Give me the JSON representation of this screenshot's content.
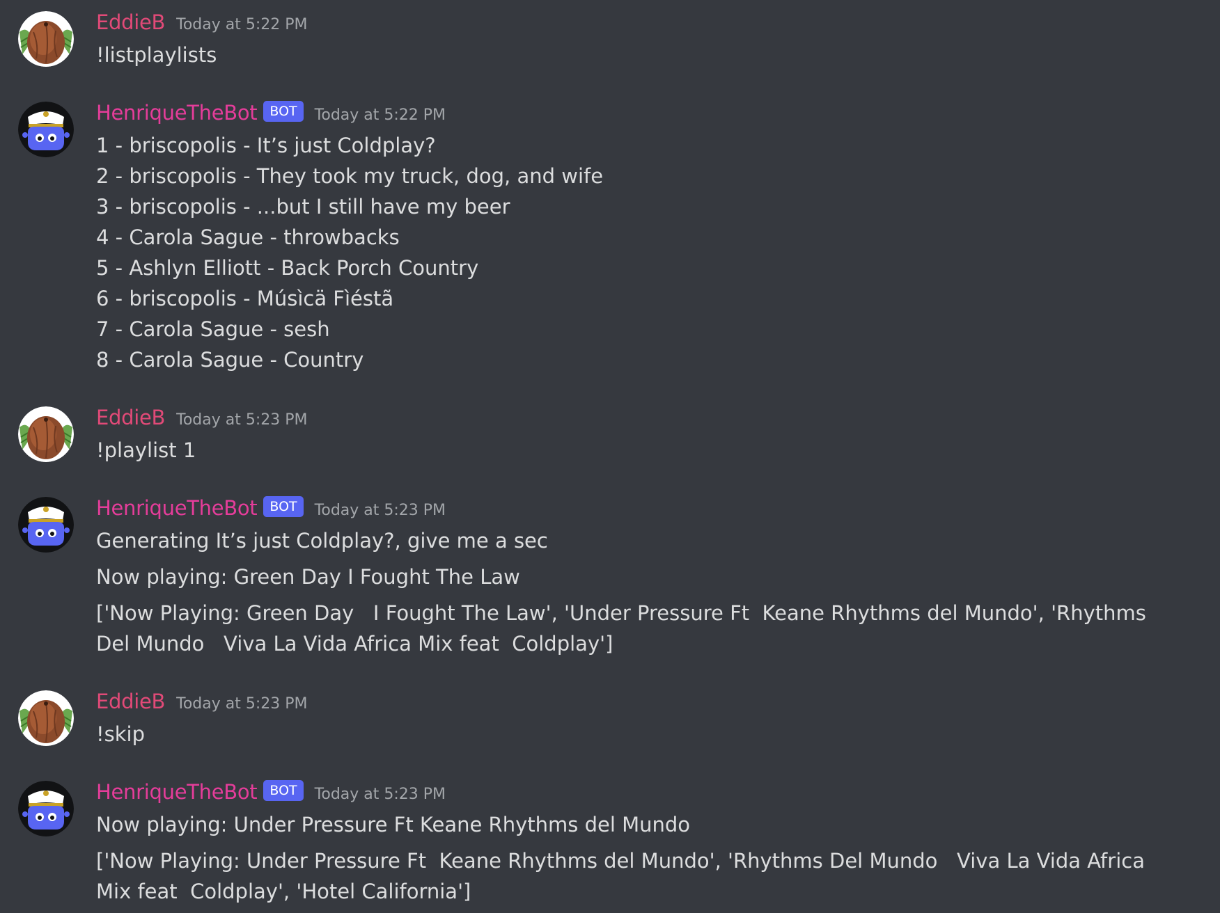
{
  "messages": [
    {
      "author": "EddieB",
      "is_bot": false,
      "timestamp": "Today at 5:22 PM",
      "lines": [
        "!listplaylists"
      ]
    },
    {
      "author": "HenriqueTheBot",
      "is_bot": true,
      "bot_tag": "BOT",
      "timestamp": "Today at 5:22 PM",
      "lines": [
        "1 - briscopolis - It’s just Coldplay?",
        "2 - briscopolis - They took my truck, dog, and wife",
        "3 - briscopolis - ...but I still have my beer",
        "4 - Carola Sague - throwbacks",
        "5 - Ashlyn Elliott - Back Porch Country",
        "6 - briscopolis - Músìcä Fìéstã",
        "7 - Carola Sague - sesh",
        "8 - Carola Sague - Country"
      ]
    },
    {
      "author": "EddieB",
      "is_bot": false,
      "timestamp": "Today at 5:23 PM",
      "lines": [
        "!playlist 1"
      ]
    },
    {
      "author": "HenriqueTheBot",
      "is_bot": true,
      "bot_tag": "BOT",
      "timestamp": "Today at 5:23 PM",
      "lines": [
        "Generating It’s just Coldplay?, give me a sec",
        "Now playing: Green Day   I Fought The Law",
        "['Now Playing: Green Day   I Fought The Law', 'Under Pressure Ft  Keane Rhythms del Mundo', 'Rhythms Del Mundo   Viva La Vida Africa Mix feat  Coldplay']"
      ]
    },
    {
      "author": "EddieB",
      "is_bot": false,
      "timestamp": "Today at 5:23 PM",
      "lines": [
        "!skip"
      ]
    },
    {
      "author": "HenriqueTheBot",
      "is_bot": true,
      "bot_tag": "BOT",
      "timestamp": "Today at 5:23 PM",
      "lines": [
        "Now playing: Under Pressure Ft  Keane Rhythms del Mundo",
        "['Now Playing: Under Pressure Ft  Keane Rhythms del Mundo', 'Rhythms Del Mundo   Viva La Vida Africa Mix feat  Coldplay', 'Hotel California']"
      ]
    }
  ],
  "colors": {
    "background": "#36393f",
    "user_name": "#e24a78",
    "bot_name": "#e53d9a",
    "bot_tag": "#5865f2",
    "timestamp": "#a3a6aa",
    "text": "#dcddde"
  },
  "icons": {
    "user_avatar": "coconut-avatar-icon",
    "bot_avatar": "captain-robot-avatar-icon"
  }
}
